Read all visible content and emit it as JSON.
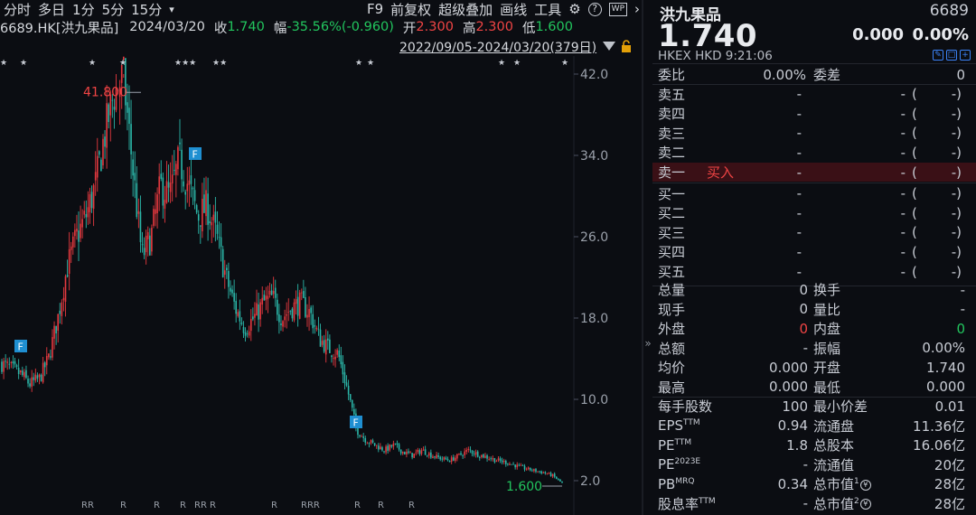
{
  "toolbar": {
    "items": [
      "分时",
      "多日",
      "1分",
      "5分",
      "15分"
    ],
    "menu_arrow": "▾",
    "right": [
      "F9",
      "前复权",
      "超级叠加",
      "画线",
      "工具"
    ],
    "settings_icon": "gear-icon",
    "help_icon": "help-icon",
    "wp_label": "WP",
    "next_icon": "chevron-right-icon"
  },
  "info": {
    "code": "6689.HK[洪九果品]",
    "date": "2024/03/20",
    "close_label": "收",
    "close": "1.740",
    "range_label": "幅",
    "range": "-35.56%(-0.960)",
    "open_label": "开",
    "open": "2.300",
    "high_label": "高",
    "high": "2.300",
    "low_label": "低",
    "low": "1.600"
  },
  "period": "2022/09/05-2024/03/20(379日)",
  "chart_data": {
    "type": "candlestick",
    "y_ticks": [
      "42.0",
      "34.0",
      "26.0",
      "18.0",
      "10.0",
      "2.0"
    ],
    "ylim": [
      2,
      42
    ],
    "max_label": "41.800",
    "min_label": "1.600",
    "event_flags": [
      "F",
      "F",
      "F"
    ],
    "rights_markers": [
      "RR",
      "R",
      "R",
      "R",
      "RR",
      "R",
      "R",
      "RRR",
      "R",
      "R",
      "R"
    ],
    "star_markers": [
      "★",
      "★",
      "★",
      "★",
      "★★★",
      "★★",
      "★",
      "★",
      "★",
      "★",
      "★"
    ],
    "price_path": [
      13.5,
      13.0,
      12.5,
      11.5,
      12.0,
      14.0,
      18.0,
      23.0,
      26.0,
      28.0,
      31.0,
      36.0,
      40.0,
      41.8,
      33.0,
      24.0,
      26.0,
      31.0,
      30.0,
      33.5,
      31.0,
      28.0,
      29.0,
      26.0,
      22.0,
      19.0,
      17.0,
      18.0,
      19.5,
      20.0,
      18.0,
      19.0,
      19.5,
      18.5,
      16.0,
      15.0,
      14.5,
      11.0,
      7.0,
      6.0,
      5.5,
      5.0,
      5.5,
      4.8,
      4.5,
      5.0,
      4.5,
      4.2,
      4.0,
      4.5,
      5.0,
      4.6,
      4.3,
      4.0,
      3.8,
      3.5,
      3.2,
      3.0,
      2.8,
      2.5,
      1.74
    ]
  },
  "quote": {
    "name": "洪九果品",
    "code": "6689",
    "price": "1.740",
    "change": "0.000",
    "change_pct": "0.00%",
    "market": "HKEX  HKD  9:21:06"
  },
  "orderbook": {
    "weibi_label": "委比",
    "weibi": "0.00%",
    "weicha_label": "委差",
    "weicha": "0",
    "asks": [
      {
        "label": "卖五",
        "price": "-",
        "vol": "-",
        "open": "(",
        "close": "-)"
      },
      {
        "label": "卖四",
        "price": "-",
        "vol": "-",
        "open": "(",
        "close": "-)"
      },
      {
        "label": "卖三",
        "price": "-",
        "vol": "-",
        "open": "(",
        "close": "-)"
      },
      {
        "label": "卖二",
        "price": "-",
        "vol": "-",
        "open": "(",
        "close": "-)"
      },
      {
        "label": "卖一",
        "price": "-",
        "vol": "-",
        "open": "(",
        "close": "-)"
      }
    ],
    "buy_label": "买入",
    "bids": [
      {
        "label": "买一",
        "price": "-",
        "vol": "-",
        "open": "(",
        "close": "-)"
      },
      {
        "label": "买二",
        "price": "-",
        "vol": "-",
        "open": "(",
        "close": "-)"
      },
      {
        "label": "买三",
        "price": "-",
        "vol": "-",
        "open": "(",
        "close": "-)"
      },
      {
        "label": "买四",
        "price": "-",
        "vol": "-",
        "open": "(",
        "close": "-)"
      },
      {
        "label": "买五",
        "price": "-",
        "vol": "-",
        "open": "(",
        "close": "-)"
      }
    ]
  },
  "stats": [
    {
      "l1": "总量",
      "v1": "0",
      "l2": "换手",
      "v2": "-"
    },
    {
      "l1": "现手",
      "v1": "0",
      "l2": "量比",
      "v2": "-"
    },
    {
      "l1": "外盘",
      "v1": "0",
      "l2": "内盘",
      "v2": "0"
    },
    {
      "l1": "总额",
      "v1": "-",
      "l2": "振幅",
      "v2": "0.00%"
    },
    {
      "l1": "均价",
      "v1": "0.000",
      "l2": "开盘",
      "v2": "1.740"
    },
    {
      "l1": "最高",
      "v1": "0.000",
      "l2": "最低",
      "v2": "0.000"
    },
    {
      "l1": "每手股数",
      "v1": "100",
      "l2": "最小价差",
      "v2": "0.01"
    },
    {
      "l1": "EPS",
      "l1sup": "TTM",
      "v1": "0.94",
      "l2": "流通盘",
      "v2": "11.36亿"
    },
    {
      "l1": "PE",
      "l1sup": "TTM",
      "v1": "1.8",
      "l2": "总股本",
      "v2": "16.06亿"
    },
    {
      "l1": "PE",
      "l1sup": "2023E",
      "v1": "-",
      "l2": "流通值",
      "v2": "20亿"
    },
    {
      "l1": "PB",
      "l1sup": "MRQ",
      "v1": "0.34",
      "l2": "总市值",
      "l2sup": "1",
      "l2circ": "¥",
      "v2": "28亿"
    },
    {
      "l1": "股息率",
      "l1sup": "TTM",
      "v1": "-",
      "l2": "总市值",
      "l2sup": "2",
      "l2circ": "¥",
      "v2": "28亿"
    }
  ],
  "colors": {
    "up": "#ef4444",
    "down": "#22c55e",
    "neutral": "#c8ccd4",
    "flag": "#1f8fd1"
  }
}
